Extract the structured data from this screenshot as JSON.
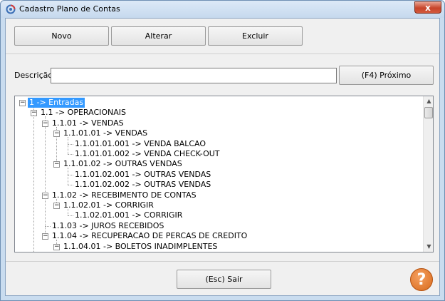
{
  "window": {
    "title": "Cadastro Plano de Contas",
    "close_glyph": "x"
  },
  "toolbar": {
    "novo_label": "Novo",
    "alterar_label": "Alterar",
    "excluir_label": "Excluir"
  },
  "search": {
    "label": "Descrição:",
    "value": "",
    "next_label": "(F4) Próximo"
  },
  "tree": {
    "nodes": [
      {
        "text": "1 -> Entradas",
        "selected": true
      },
      {
        "text": "1.1 -> OPERACIONAIS"
      },
      {
        "text": "1.1.01 -> VENDAS"
      },
      {
        "text": "1.1.01.01 -> VENDAS"
      },
      {
        "text": "1.1.01.01.001 -> VENDA BALCAO"
      },
      {
        "text": "1.1.01.01.002 -> VENDA CHECK-OUT"
      },
      {
        "text": "1.1.01.02 -> OUTRAS VENDAS"
      },
      {
        "text": "1.1.01.02.001 -> OUTRAS VENDAS"
      },
      {
        "text": "1.1.01.02.002 -> OUTRAS VENDAS"
      },
      {
        "text": "1.1.02 -> RECEBIMENTO DE CONTAS"
      },
      {
        "text": "1.1.02.01 -> CORRIGIR"
      },
      {
        "text": "1.1.02.01.001 -> CORRIGIR"
      },
      {
        "text": "1.1.03 -> JUROS RECEBIDOS"
      },
      {
        "text": "1.1.04 -> RECUPERACAO DE PERCAS DE CREDITO"
      },
      {
        "text": "1.1.04.01 -> BOLETOS INADIMPLENTES"
      }
    ]
  },
  "footer": {
    "exit_label": "(Esc) Sair",
    "help_glyph": "?"
  },
  "colors": {
    "selection": "#3399ff",
    "help_icon": "#d86a1c",
    "close_button": "#c7442a"
  }
}
